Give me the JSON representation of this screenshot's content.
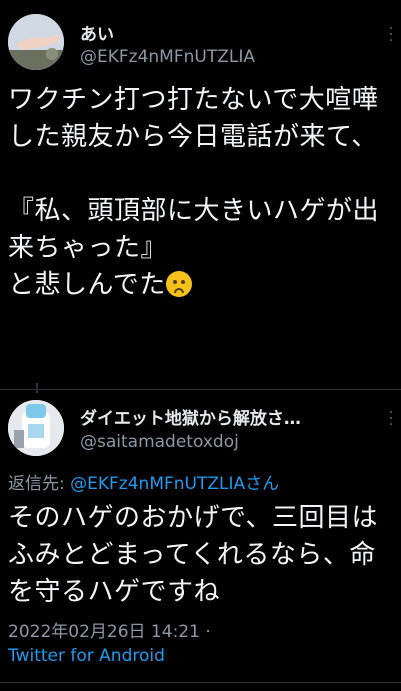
{
  "tweet1": {
    "display_name": "あい",
    "handle": "@EKFz4nMFnUTZLIA",
    "text": "ワクチン打つ打たないで大喧嘩した親友から今日電話が来て、\n\n『私、頭頂部に大きいハゲが出来ちゃった』\nと悲しんでた",
    "emoji": "disappointed-face-emoji"
  },
  "tweet2": {
    "display_name": "ダイエット地獄から解放さ…",
    "handle": "@saitamadetoxdoj",
    "reply_prefix": "返信先: ",
    "reply_mention": "@EKFz4nMFnUTZLIAさん",
    "text": "そのハゲのおかげで、三回目はふみとどまってくれるなら、命を守るハゲですね",
    "timestamp": "2022年02月26日 14:21 ·",
    "source": "Twitter for Android"
  },
  "colors": {
    "background": "#000000",
    "text": "#e7e9ea",
    "secondary": "#8b98a5",
    "accent": "#1d9bf0"
  }
}
